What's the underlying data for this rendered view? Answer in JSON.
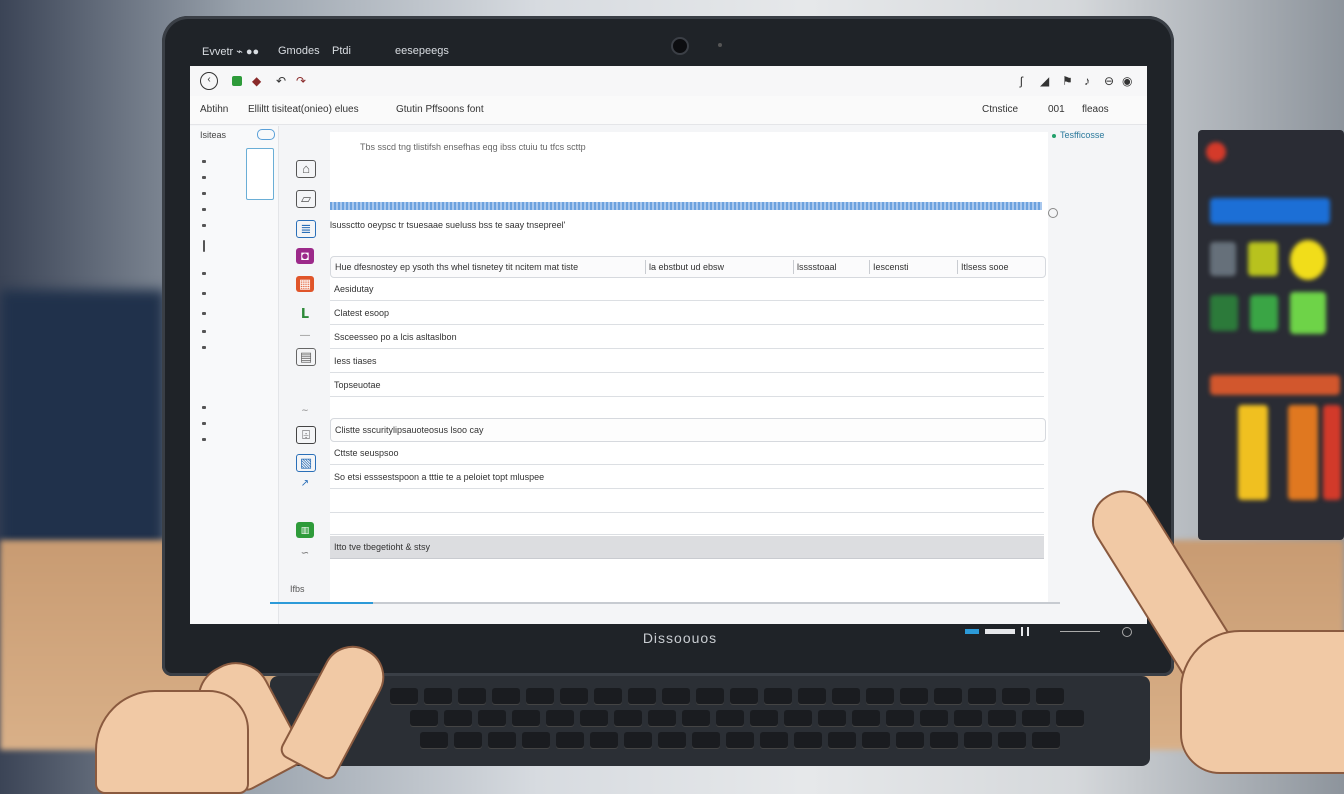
{
  "menubar": {
    "items": [
      "Evvetr ⌁ ●●",
      "Gmodes",
      "Ptdi",
      "eesepeegs"
    ]
  },
  "toolbar": {
    "left_icons": [
      "back-icon",
      "stop-icon",
      "tag-icon",
      "tilde-icon",
      "redo-icon"
    ],
    "right_icons": [
      "search-icon",
      "bell-icon",
      "flag-icon",
      "music-icon",
      "power-icon"
    ]
  },
  "subtoolbar": {
    "left": "Abtihn",
    "path": "Elliltt tisiteat(onieo) elues",
    "mode": "Gtutin  Pffsoons font",
    "right_a": "Ctnstice",
    "right_b": "001",
    "right_c": "fleaos"
  },
  "rail": {
    "label": "Isiteas"
  },
  "main": {
    "top_note": "Tbs sscd tng tlistifsh ensefhas eqg ibss ctuiu tu tfcs scttp",
    "timeline_note": "lsussctto  oeypsc tr tsuesaae sueluss bss te saay tnsepreel'",
    "columns": [
      "Hue dfesnostey ep ysoth ths whel tisnetey tit ncitem mat tiste",
      "la ebstbut  ud  ebsw",
      "lsssstoaal",
      "Iescensti",
      "Itlsess sooe"
    ],
    "rows": [
      "Aesidutay",
      "Clatest esoop",
      "Ssceesseo po a lcis asltaslbon",
      "Iess tiases",
      "Topseuotae",
      "",
      "Clistte sscuritylipsauoteosus lsoo cay",
      "Cttste seuspsoo",
      "So etsi esssestspoon a tttie te a peloiet topt mluspee",
      "",
      "",
      "Itto tve tbegetioht & stsy"
    ],
    "right_link": "Tesfficosse",
    "bottom_status": "Ifbs"
  },
  "brand": "Dissoouos",
  "colors": {
    "accent": "#2c9ad8",
    "timeline": "#6da2de",
    "selected_row": "#dcdde0"
  },
  "progress": 0.13
}
